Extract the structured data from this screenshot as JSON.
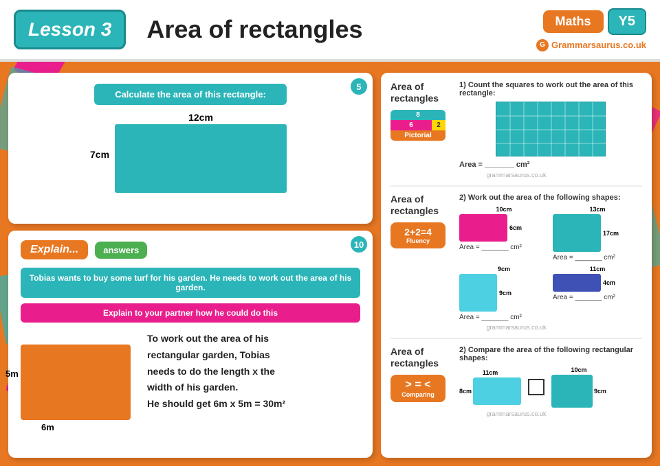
{
  "header": {
    "lesson_label": "Lesson 3",
    "title": "Area of rectangles",
    "subject": "Maths",
    "year": "Y5",
    "website": "Grammarsaurus.co.uk"
  },
  "slide1": {
    "number": "5",
    "calc_btn": "Calculate the area of this rectangle:",
    "width": "12cm",
    "height": "7cm"
  },
  "slide2": {
    "number": "10",
    "explain_label": "Explain...",
    "answers_label": "answers",
    "info_text": "Tobias wants to buy some turf for his garden. He needs to work out the area of his garden.",
    "partner_text": "Explain to your partner how he could do this",
    "garden_width": "6m",
    "garden_height": "5m",
    "solution_line1": "To work out the area of his",
    "solution_line2": "rectangular garden, Tobias",
    "solution_line3": "needs to do the length x the",
    "solution_line4": "width of his garden.",
    "solution_line5": "He should get 6m x 5m = 30m²"
  },
  "worksheet": {
    "section1": {
      "label": "Area of rectangles",
      "badge_top": "8",
      "badge_mid_left": "6",
      "badge_mid_right": "2",
      "badge_bot": "Pictorial",
      "question": "1) Count the squares to work out the area of this rectangle:",
      "area_label": "Area = _______ cm²"
    },
    "section2": {
      "label": "Area of rectangles",
      "fluency_math": "2+2=4",
      "fluency_label": "Fluency",
      "question": "2) Work out the area of the following shapes:",
      "shapes": [
        {
          "color": "pink",
          "width_label": "10cm",
          "height_label": "6cm",
          "area": "Area = _______ cm²"
        },
        {
          "color": "teal",
          "width_label": "13cm",
          "height_label": "17cm",
          "area": "Area = _______ cm²"
        },
        {
          "color": "teal2",
          "width_label": "9cm",
          "height_label": "9cm",
          "area": "Area = _______ cm²"
        },
        {
          "color": "blue",
          "width_label": "11cm",
          "height_label": "4cm",
          "area": "Area = _______ cm²"
        }
      ]
    },
    "section3": {
      "label": "Area of rectangles",
      "comparing_icons": "> = <",
      "comparing_label": "Comparing",
      "question": "2) Compare the area of the following rectangular shapes:",
      "shape1_width": "11cm",
      "shape1_height": "8cm",
      "shape2_width": "10cm",
      "shape2_height": "9cm"
    }
  }
}
